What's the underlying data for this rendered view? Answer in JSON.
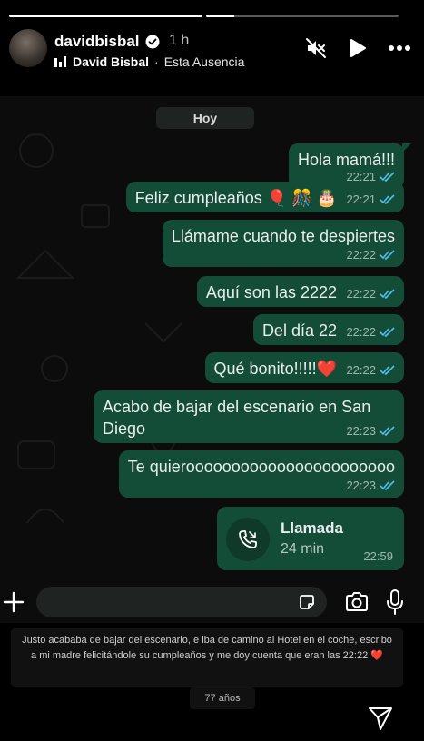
{
  "story": {
    "progress": [
      1.0,
      0.15
    ],
    "username": "davidbisbal",
    "time_ago": "1 h",
    "music_artist": "David Bisbal",
    "music_separator": "·",
    "music_song": "Esta Ausencia",
    "icons": [
      "mute-icon",
      "play-icon",
      "more-icon"
    ]
  },
  "chat": {
    "date_chip": "Hoy",
    "accent": "#144d37",
    "messages": [
      {
        "text": "Hola mamá!!!",
        "time": "22:21"
      },
      {
        "text": "Feliz cumpleaños 🎈 🎊 🎂",
        "time": "22:21"
      },
      {
        "text": "Llámame cuando te despiertes",
        "time": "22:22"
      },
      {
        "text": "Aquí son las 2222",
        "time": "22:22"
      },
      {
        "text": "Del día 22",
        "time": "22:22"
      },
      {
        "text": "Qué bonito!!!!!❤️",
        "time": "22:22"
      },
      {
        "text": "Acabo de bajar del escenario en San Diego",
        "time": "22:23"
      },
      {
        "text": "Te quierooooooooooooooooooooooo",
        "time": "22:23"
      }
    ],
    "call": {
      "title": "Llamada",
      "duration": "24 min",
      "time": "22:59"
    }
  },
  "caption": {
    "text": "Justo acababa de bajar del escenario, e iba de camino al Hotel en el coche, escribo a mi madre felicitándole su cumpleaños y me doy cuenta que eran las 22:22 ❤️",
    "age_badge": "77 años"
  }
}
